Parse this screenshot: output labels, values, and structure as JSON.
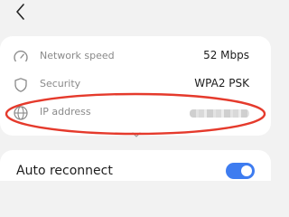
{
  "header": {
    "back_icon": "chevron-left-icon"
  },
  "details": {
    "network_speed": {
      "label": "Network speed",
      "value": "52 Mbps",
      "icon": "speedometer-icon"
    },
    "security": {
      "label": "Security",
      "value": "WPA2 PSK",
      "icon": "shield-icon"
    },
    "ip_address": {
      "label": "IP address",
      "icon": "globe-icon"
    },
    "expand_icon": "chevron-down-icon"
  },
  "annotation": {
    "color": "#e53a2c"
  },
  "auto_reconnect": {
    "label": "Auto reconnect",
    "enabled": true,
    "accent": "#3e7cf0"
  }
}
